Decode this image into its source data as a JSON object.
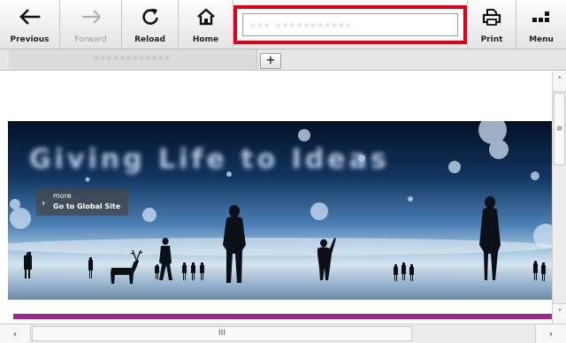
{
  "toolbar": {
    "previous": "Previous",
    "forward": "Forward",
    "reload": "Reload",
    "home": "Home",
    "print": "Print",
    "menu": "Menu"
  },
  "address_bar": {
    "value": "••• •••••••••••",
    "highlight_color": "#e0001b"
  },
  "tabs": [
    {
      "title": "••••••••••••"
    }
  ],
  "new_tab_label": "+",
  "hero": {
    "title": "Giving Life to Ideas",
    "more_label": "more",
    "global_site_label": "Go to Global Site",
    "chevron": "›"
  },
  "scrollbars": {
    "up": "˄",
    "down": "˅",
    "vertical_grip": "≡",
    "left": "‹",
    "right": "›",
    "horizontal_grip": "III"
  },
  "colors": {
    "accent_band": "#a4258f",
    "disabled_icon": "#b0b0b0"
  }
}
